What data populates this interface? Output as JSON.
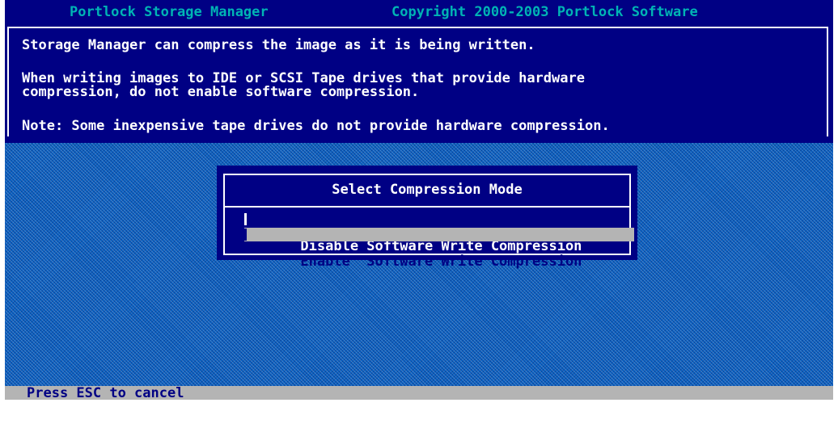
{
  "titlebar": {
    "app_name": "Portlock Storage Manager",
    "copyright": "Copyright 2000-2003 Portlock Software"
  },
  "info": {
    "line1": "Storage Manager can compress the image as it is being written.",
    "line2a": "When writing images to IDE or SCSI Tape drives that provide hardware",
    "line2b": "compression, do not enable software compression.",
    "line3": "Note: Some inexpensive tape drives do not provide hardware compression."
  },
  "dialog": {
    "title": "Select Compression Mode",
    "options": [
      {
        "label": "Disable Software Write Compression",
        "selected": false
      },
      {
        "label": "Enable  Software Write Compression",
        "selected": true
      }
    ]
  },
  "statusbar": {
    "hint": "Press ESC to cancel"
  },
  "colors": {
    "panel_blue": "#000084",
    "title_cyan": "#00b4b4",
    "desktop_blue": "#0a5fbf",
    "highlight_gray": "#b4b4b4"
  }
}
